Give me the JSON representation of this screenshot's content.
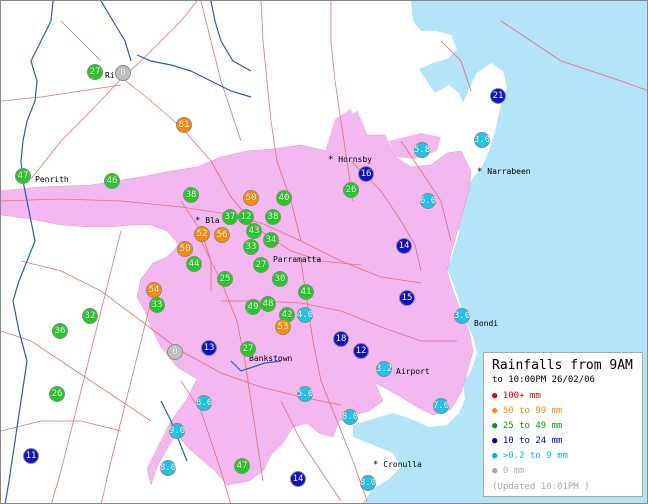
{
  "legend": {
    "title": "Rainfalls from 9AM",
    "subtitle": "to 10:00PM 26/02/06",
    "updated": "(Updated 10:01PM )",
    "categories": [
      {
        "symbol": "●",
        "label": "100+ mm",
        "color": "#e00000"
      },
      {
        "symbol": "●",
        "label": "50  to 99 mm",
        "color": "#ff8c00"
      },
      {
        "symbol": "●",
        "label": "25  to 49 mm",
        "color": "#00a000"
      },
      {
        "symbol": "●",
        "label": "10  to 24 mm",
        "color": "#0000c0"
      },
      {
        "symbol": "●",
        "label": ">0.2 to 9 mm",
        "color": "#00b8e0"
      },
      {
        "symbol": "●",
        "label": "0 mm",
        "color": "#aaaaaa"
      }
    ]
  },
  "colors": {
    "sea": "#b4e4f8",
    "urban": "#f3b8f0",
    "roads": "#e87070",
    "rivers": "#2060c0",
    "bins": {
      "100+": "#e00000",
      "50-99": "#ff8c00",
      "25-49": "#22cc22",
      "10-24": "#1010d0",
      "0.2-9": "#20c4e8",
      "0": "#c0c0c0"
    }
  },
  "places": [
    {
      "name": "Richmond",
      "fragment": "Ri     nd"
    },
    {
      "name": "Penrith",
      "fragment": "Penrith"
    },
    {
      "name": "Blacktown",
      "fragment": "Bla"
    },
    {
      "name": "Hornsby",
      "fragment": "Hornsby"
    },
    {
      "name": "Narrabeen",
      "fragment": "Narrabeen"
    },
    {
      "name": "Parramatta",
      "fragment": "Parramatta"
    },
    {
      "name": "Bankstown",
      "fragment": "Bankstown"
    },
    {
      "name": "Bondi",
      "fragment": "Bondi"
    },
    {
      "name": "Airport",
      "fragment": "Airport"
    },
    {
      "name": "Cronulla",
      "fragment": "Cronulla"
    }
  ],
  "stations": [
    {
      "value": "27",
      "bin": "25-49"
    },
    {
      "value": "0",
      "bin": "0"
    },
    {
      "value": "81",
      "bin": "50-99"
    },
    {
      "value": "47",
      "bin": "25-49"
    },
    {
      "value": "46",
      "bin": "25-49"
    },
    {
      "value": "38",
      "bin": "25-49"
    },
    {
      "value": "50",
      "bin": "50-99"
    },
    {
      "value": "40",
      "bin": "25-49"
    },
    {
      "value": "26",
      "bin": "25-49"
    },
    {
      "value": "16",
      "bin": "10-24"
    },
    {
      "value": "5.8",
      "bin": "0.2-9"
    },
    {
      "value": "3.0",
      "bin": "0.2-9"
    },
    {
      "value": "21",
      "bin": "10-24"
    },
    {
      "value": "6.0",
      "bin": "0.2-9"
    },
    {
      "value": "37",
      "bin": "25-49"
    },
    {
      "value": "12",
      "bin": "25-49"
    },
    {
      "value": "38",
      "bin": "25-49"
    },
    {
      "value": "52",
      "bin": "50-99"
    },
    {
      "value": "56",
      "bin": "50-99"
    },
    {
      "value": "43",
      "bin": "25-49"
    },
    {
      "value": "33",
      "bin": "25-49"
    },
    {
      "value": "34",
      "bin": "25-49"
    },
    {
      "value": "50",
      "bin": "50-99"
    },
    {
      "value": "44",
      "bin": "25-49"
    },
    {
      "value": "27",
      "bin": "25-49"
    },
    {
      "value": "25",
      "bin": "25-49"
    },
    {
      "value": "30",
      "bin": "25-49"
    },
    {
      "value": "14",
      "bin": "10-24"
    },
    {
      "value": "54",
      "bin": "50-99"
    },
    {
      "value": "33",
      "bin": "25-49"
    },
    {
      "value": "41",
      "bin": "25-49"
    },
    {
      "value": "49",
      "bin": "25-49"
    },
    {
      "value": "48",
      "bin": "25-49"
    },
    {
      "value": "42",
      "bin": "25-49"
    },
    {
      "value": "4.0",
      "bin": "0.2-9"
    },
    {
      "value": "53",
      "bin": "50-99"
    },
    {
      "value": "15",
      "bin": "10-24"
    },
    {
      "value": "3.0",
      "bin": "0.2-9"
    },
    {
      "value": "36",
      "bin": "25-49"
    },
    {
      "value": "32",
      "bin": "25-49"
    },
    {
      "value": "0",
      "bin": "0"
    },
    {
      "value": "13",
      "bin": "10-24"
    },
    {
      "value": "27",
      "bin": "25-49"
    },
    {
      "value": "18",
      "bin": "10-24"
    },
    {
      "value": "12",
      "bin": "10-24"
    },
    {
      "value": "3.2",
      "bin": "0.2-9"
    },
    {
      "value": "26",
      "bin": "25-49"
    },
    {
      "value": "8.6",
      "bin": "0.2-9"
    },
    {
      "value": "5.0",
      "bin": "0.2-9"
    },
    {
      "value": "8.0",
      "bin": "0.2-9"
    },
    {
      "value": "7.0",
      "bin": "0.2-9"
    },
    {
      "value": "9.0",
      "bin": "0.2-9"
    },
    {
      "value": "11",
      "bin": "10-24"
    },
    {
      "value": "8.0",
      "bin": "0.2-9"
    },
    {
      "value": "47",
      "bin": "25-49"
    },
    {
      "value": "14",
      "bin": "10-24"
    },
    {
      "value": "8.0",
      "bin": "0.2-9"
    }
  ]
}
